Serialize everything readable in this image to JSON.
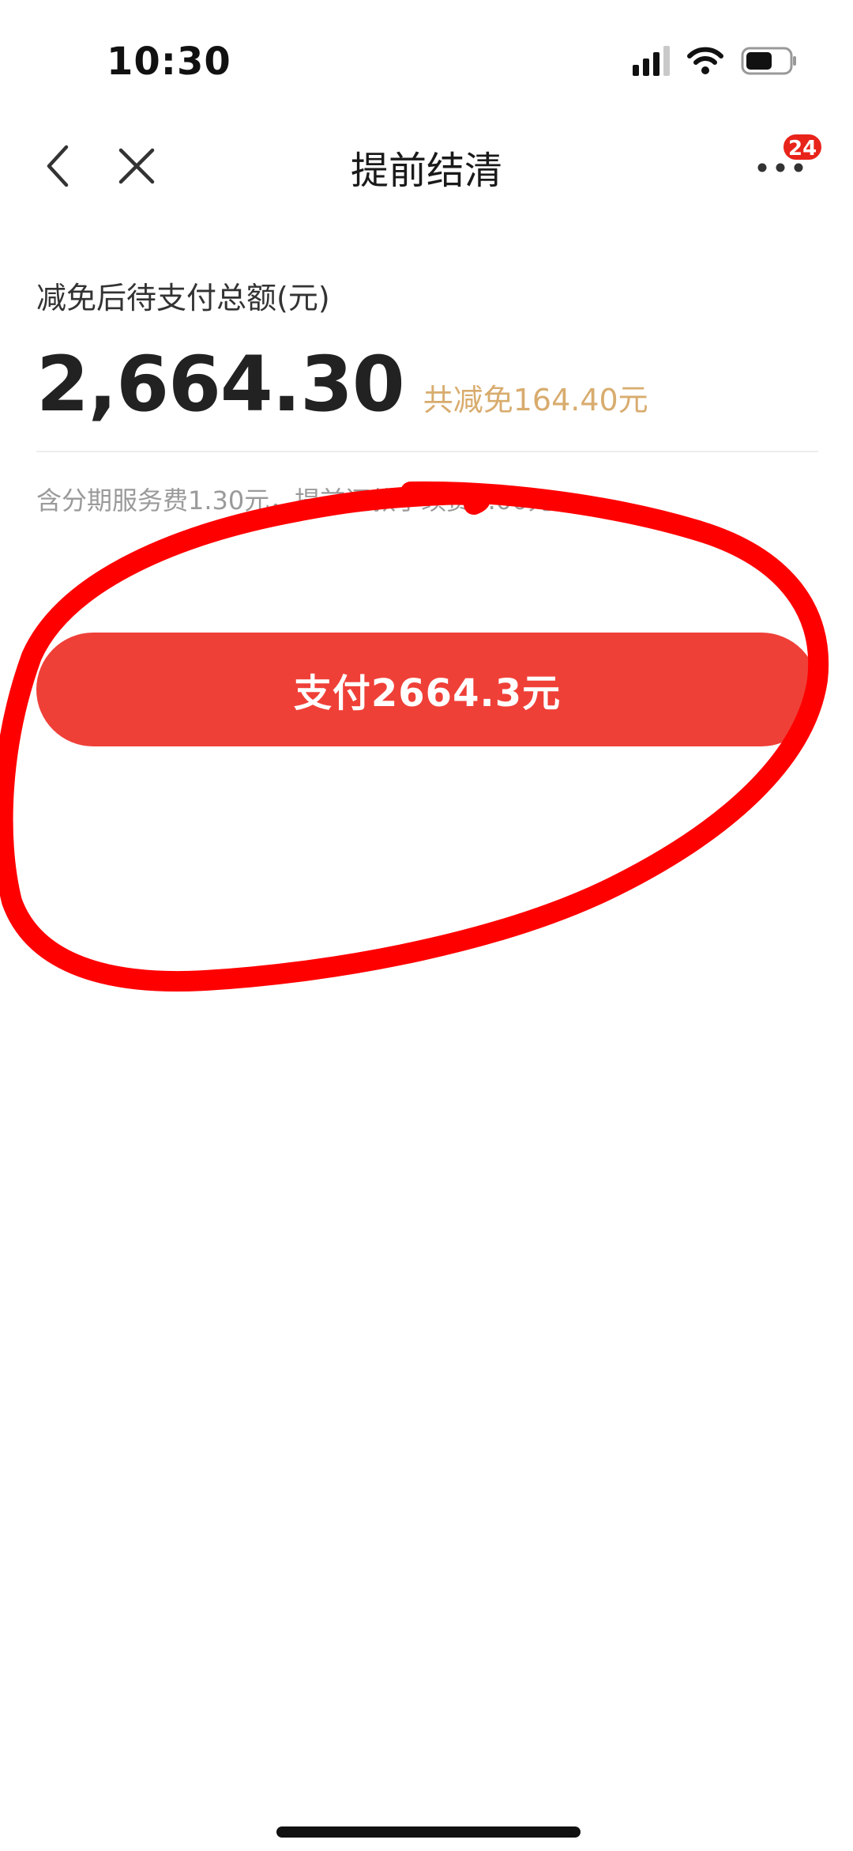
{
  "status_bar": {
    "time": "10:30"
  },
  "nav": {
    "title": "提前结清",
    "badge_count": "24"
  },
  "summary": {
    "label": "减免后待支付总额(元)",
    "amount": "2,664.30",
    "discount": "共减免164.40元",
    "fee_text": "含分期服务费1.30元，提前还款手续费0.00元"
  },
  "pay_button": {
    "label": "支付2664.3元"
  },
  "colors": {
    "accent": "#ef4038",
    "discount": "#d8ac6e",
    "badge": "#e8231a",
    "annotation": "#ff0000"
  }
}
